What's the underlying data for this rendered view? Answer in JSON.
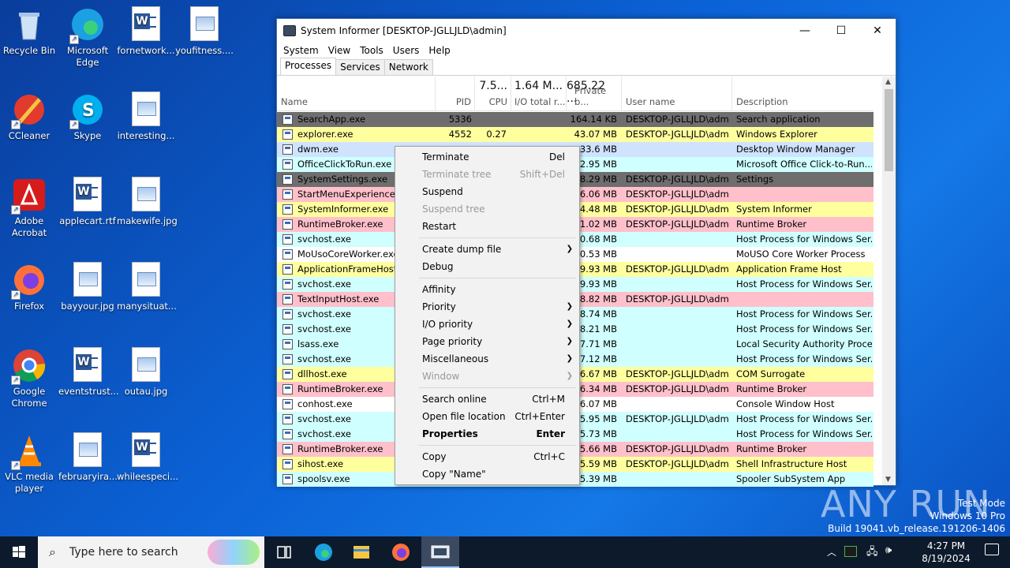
{
  "desktop": {
    "icons": [
      {
        "label": "Recycle Bin"
      },
      {
        "label": "Microsoft Edge"
      },
      {
        "label": "fornetwork..."
      },
      {
        "label": "youfitness...."
      },
      {
        "label": "CCleaner"
      },
      {
        "label": "Skype"
      },
      {
        "label": "interesting..."
      },
      {
        "label": "Adobe Acrobat"
      },
      {
        "label": "applecart.rtf"
      },
      {
        "label": "makewife.jpg"
      },
      {
        "label": "Firefox"
      },
      {
        "label": "bayyour.jpg"
      },
      {
        "label": "manysituat..."
      },
      {
        "label": "Google Chrome"
      },
      {
        "label": "eventstrust..."
      },
      {
        "label": "outau.jpg"
      },
      {
        "label": "VLC media player"
      },
      {
        "label": "februaryira..."
      },
      {
        "label": "whileespeci..."
      }
    ]
  },
  "window": {
    "title": "System Informer [DESKTOP-JGLLJLD\\admin]",
    "controls": {
      "minimize": "—",
      "maximize": "☐",
      "close": "✕"
    },
    "menu": [
      "System",
      "View",
      "Tools",
      "Users",
      "Help"
    ],
    "tabs": [
      "Processes",
      "Services",
      "Network"
    ],
    "columns": {
      "name": "Name",
      "pid": "PID",
      "cpu_total": "7.5...",
      "cpu": "CPU",
      "io_total_top": "1.64 M...",
      "io": "I/O total r...",
      "private_top": "685.22 ...",
      "private": "Private b...",
      "user": "User name",
      "desc": "Description"
    },
    "processes": [
      {
        "name": "SearchApp.exe",
        "pid": "5336",
        "cpu": "",
        "io": "",
        "private": "164.14 KB",
        "user": "DESKTOP-JGLLJLD\\admi",
        "desc": "Search application",
        "color": "#6e6e6e",
        "fg": "#000"
      },
      {
        "name": "explorer.exe",
        "pid": "4552",
        "cpu": "0.27",
        "io": "",
        "private": "43.07 MB",
        "user": "DESKTOP-JGLLJLD\\admi",
        "desc": "Windows Explorer",
        "color": "#ffff9e",
        "fg": "#000"
      },
      {
        "name": "dwm.exe",
        "pid": "",
        "cpu": "",
        "io": "",
        "private": "33.6 MB",
        "user": "",
        "desc": "Desktop Window Manager",
        "color": "#cfe3ff",
        "fg": "#000"
      },
      {
        "name": "OfficeClickToRun.exe",
        "pid": "",
        "cpu": "",
        "io": "",
        "private": "2.95 MB",
        "user": "",
        "desc": "Microsoft Office Click-to-Run...",
        "color": "#d0ffff",
        "fg": "#000"
      },
      {
        "name": "SystemSettings.exe",
        "pid": "",
        "cpu": "",
        "io": "",
        "private": "8.29 MB",
        "user": "DESKTOP-JGLLJLD\\admi",
        "desc": "Settings",
        "color": "#6e6e6e",
        "fg": "#000"
      },
      {
        "name": "StartMenuExperienceHo",
        "pid": "",
        "cpu": "",
        "io": "",
        "private": "6.06 MB",
        "user": "DESKTOP-JGLLJLD\\admi",
        "desc": "",
        "color": "#ffc0cb",
        "fg": "#000"
      },
      {
        "name": "SystemInformer.exe",
        "pid": "",
        "cpu": "",
        "io": "",
        "private": "4.48 MB",
        "user": "DESKTOP-JGLLJLD\\admi",
        "desc": "System Informer",
        "color": "#ffff9e",
        "fg": "#000"
      },
      {
        "name": "RuntimeBroker.exe",
        "pid": "",
        "cpu": "",
        "io": "",
        "private": "1.02 MB",
        "user": "DESKTOP-JGLLJLD\\admi",
        "desc": "Runtime Broker",
        "color": "#ffc0cb",
        "fg": "#000"
      },
      {
        "name": "svchost.exe",
        "pid": "",
        "cpu": "",
        "io": "",
        "private": "0.68 MB",
        "user": "",
        "desc": "Host Process for Windows Ser...",
        "color": "#d0ffff",
        "fg": "#000"
      },
      {
        "name": "MoUsoCoreWorker.exe",
        "pid": "",
        "cpu": "",
        "io": "",
        "private": "0.53 MB",
        "user": "",
        "desc": "MoUSO Core Worker Process",
        "color": "#ffffff",
        "fg": "#000"
      },
      {
        "name": "ApplicationFrameHost.",
        "pid": "",
        "cpu": "",
        "io": "",
        "private": "9.93 MB",
        "user": "DESKTOP-JGLLJLD\\admi",
        "desc": "Application Frame Host",
        "color": "#ffff9e",
        "fg": "#000"
      },
      {
        "name": "svchost.exe",
        "pid": "",
        "cpu": "",
        "io": "",
        "private": "9.93 MB",
        "user": "",
        "desc": "Host Process for Windows Ser...",
        "color": "#d0ffff",
        "fg": "#000"
      },
      {
        "name": "TextInputHost.exe",
        "pid": "",
        "cpu": "",
        "io": "",
        "private": "8.82 MB",
        "user": "DESKTOP-JGLLJLD\\admi",
        "desc": "",
        "color": "#ffc0cb",
        "fg": "#000"
      },
      {
        "name": "svchost.exe",
        "pid": "",
        "cpu": "",
        "io": "",
        "private": "8.74 MB",
        "user": "",
        "desc": "Host Process for Windows Ser...",
        "color": "#d0ffff",
        "fg": "#000"
      },
      {
        "name": "svchost.exe",
        "pid": "",
        "cpu": "",
        "io": "",
        "private": "8.21 MB",
        "user": "",
        "desc": "Host Process for Windows Ser...",
        "color": "#d0ffff",
        "fg": "#000"
      },
      {
        "name": "lsass.exe",
        "pid": "",
        "cpu": "",
        "io": "",
        "private": "7.71 MB",
        "user": "",
        "desc": "Local Security Authority Proce...",
        "color": "#d0ffff",
        "fg": "#000"
      },
      {
        "name": "svchost.exe",
        "pid": "",
        "cpu": "",
        "io": "",
        "private": "7.12 MB",
        "user": "",
        "desc": "Host Process for Windows Ser...",
        "color": "#d0ffff",
        "fg": "#000"
      },
      {
        "name": "dllhost.exe",
        "pid": "",
        "cpu": "",
        "io": "",
        "private": "6.67 MB",
        "user": "DESKTOP-JGLLJLD\\admi",
        "desc": "COM Surrogate",
        "color": "#ffff9e",
        "fg": "#000"
      },
      {
        "name": "RuntimeBroker.exe",
        "pid": "",
        "cpu": "",
        "io": "",
        "private": "6.34 MB",
        "user": "DESKTOP-JGLLJLD\\admi",
        "desc": "Runtime Broker",
        "color": "#ffc0cb",
        "fg": "#000"
      },
      {
        "name": "conhost.exe",
        "pid": "",
        "cpu": "",
        "io": "",
        "private": "6.07 MB",
        "user": "",
        "desc": "Console Window Host",
        "color": "#ffffff",
        "fg": "#000"
      },
      {
        "name": "svchost.exe",
        "pid": "",
        "cpu": "",
        "io": "",
        "private": "5.95 MB",
        "user": "DESKTOP-JGLLJLD\\admi",
        "desc": "Host Process for Windows Ser...",
        "color": "#d0ffff",
        "fg": "#000"
      },
      {
        "name": "svchost.exe",
        "pid": "",
        "cpu": "",
        "io": "",
        "private": "5.73 MB",
        "user": "",
        "desc": "Host Process for Windows Ser...",
        "color": "#d0ffff",
        "fg": "#000"
      },
      {
        "name": "RuntimeBroker.exe",
        "pid": "",
        "cpu": "",
        "io": "",
        "private": "5.66 MB",
        "user": "DESKTOP-JGLLJLD\\admi",
        "desc": "Runtime Broker",
        "color": "#ffc0cb",
        "fg": "#000"
      },
      {
        "name": "sihost.exe",
        "pid": "",
        "cpu": "",
        "io": "",
        "private": "5.59 MB",
        "user": "DESKTOP-JGLLJLD\\admi",
        "desc": "Shell Infrastructure Host",
        "color": "#ffff9e",
        "fg": "#000"
      },
      {
        "name": "spoolsv.exe",
        "pid": "",
        "cpu": "",
        "io": "",
        "private": "5.39 MB",
        "user": "",
        "desc": "Spooler SubSystem App",
        "color": "#d0ffff",
        "fg": "#000"
      }
    ]
  },
  "context_menu": {
    "items": [
      {
        "label": "Terminate",
        "shortcut": "Del",
        "submenu": false,
        "disabled": false,
        "bold": false
      },
      {
        "label": "Terminate tree",
        "shortcut": "Shift+Del",
        "submenu": false,
        "disabled": true,
        "bold": false
      },
      {
        "label": "Suspend",
        "shortcut": "",
        "submenu": false,
        "disabled": false,
        "bold": false
      },
      {
        "label": "Suspend tree",
        "shortcut": "",
        "submenu": false,
        "disabled": true,
        "bold": false
      },
      {
        "label": "Restart",
        "shortcut": "",
        "submenu": false,
        "disabled": false,
        "bold": false
      },
      {
        "sep": true
      },
      {
        "label": "Create dump file",
        "shortcut": "",
        "submenu": true,
        "disabled": false,
        "bold": false
      },
      {
        "label": "Debug",
        "shortcut": "",
        "submenu": false,
        "disabled": false,
        "bold": false
      },
      {
        "sep": true
      },
      {
        "label": "Affinity",
        "shortcut": "",
        "submenu": false,
        "disabled": false,
        "bold": false
      },
      {
        "label": "Priority",
        "shortcut": "",
        "submenu": true,
        "disabled": false,
        "bold": false
      },
      {
        "label": "I/O priority",
        "shortcut": "",
        "submenu": true,
        "disabled": false,
        "bold": false
      },
      {
        "label": "Page priority",
        "shortcut": "",
        "submenu": true,
        "disabled": false,
        "bold": false
      },
      {
        "label": "Miscellaneous",
        "shortcut": "",
        "submenu": true,
        "disabled": false,
        "bold": false
      },
      {
        "label": "Window",
        "shortcut": "",
        "submenu": true,
        "disabled": true,
        "bold": false
      },
      {
        "sep": true
      },
      {
        "label": "Search online",
        "shortcut": "Ctrl+M",
        "submenu": false,
        "disabled": false,
        "bold": false
      },
      {
        "label": "Open file location",
        "shortcut": "Ctrl+Enter",
        "submenu": false,
        "disabled": false,
        "bold": false
      },
      {
        "label": "Properties",
        "shortcut": "Enter",
        "submenu": false,
        "disabled": false,
        "bold": true
      },
      {
        "sep": true
      },
      {
        "label": "Copy",
        "shortcut": "Ctrl+C",
        "submenu": false,
        "disabled": false,
        "bold": false
      },
      {
        "label": "Copy \"Name\"",
        "shortcut": "",
        "submenu": false,
        "disabled": false,
        "bold": false
      }
    ]
  },
  "taskbar": {
    "search_placeholder": "Type here to search",
    "time": "4:27 PM",
    "date": "8/19/2024"
  },
  "watermark": {
    "line1": "Test Mode",
    "line2": "Windows 10 Pro",
    "line3": "Build 19041.vb_release.191206-1406",
    "brand": "ANY RUN"
  }
}
